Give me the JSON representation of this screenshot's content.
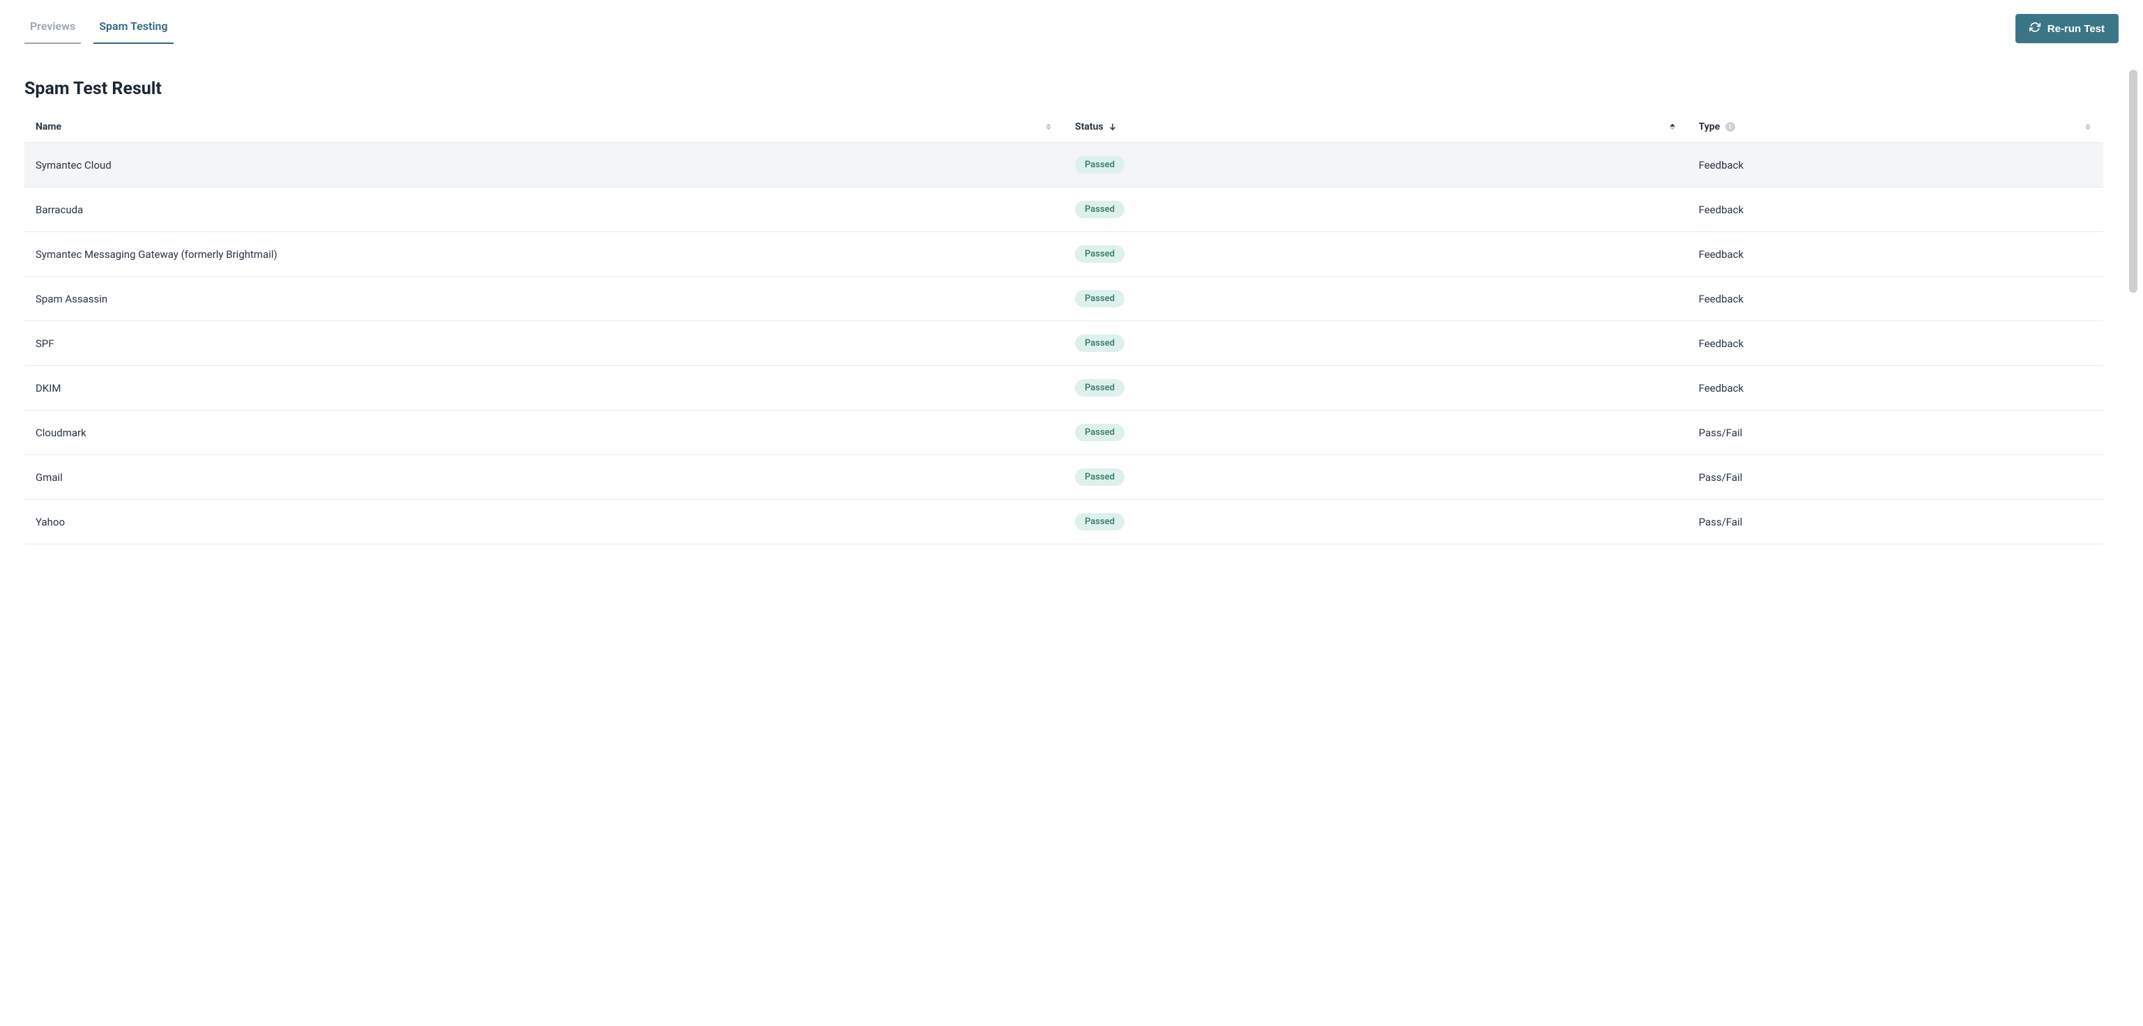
{
  "tabs": {
    "previews": "Previews",
    "spam_testing": "Spam Testing"
  },
  "rerun_button": "Re-run Test",
  "page_title": "Spam Test Result",
  "columns": {
    "name": "Name",
    "status": "Status",
    "type": "Type"
  },
  "rows": [
    {
      "name": "Symantec Cloud",
      "status": "Passed",
      "type": "Feedback"
    },
    {
      "name": "Barracuda",
      "status": "Passed",
      "type": "Feedback"
    },
    {
      "name": "Symantec Messaging Gateway (formerly Brightmail)",
      "status": "Passed",
      "type": "Feedback"
    },
    {
      "name": "Spam Assassin",
      "status": "Passed",
      "type": "Feedback"
    },
    {
      "name": "SPF",
      "status": "Passed",
      "type": "Feedback"
    },
    {
      "name": "DKIM",
      "status": "Passed",
      "type": "Feedback"
    },
    {
      "name": "Cloudmark",
      "status": "Passed",
      "type": "Pass/Fail"
    },
    {
      "name": "Gmail",
      "status": "Passed",
      "type": "Pass/Fail"
    },
    {
      "name": "Yahoo",
      "status": "Passed",
      "type": "Pass/Fail"
    }
  ]
}
